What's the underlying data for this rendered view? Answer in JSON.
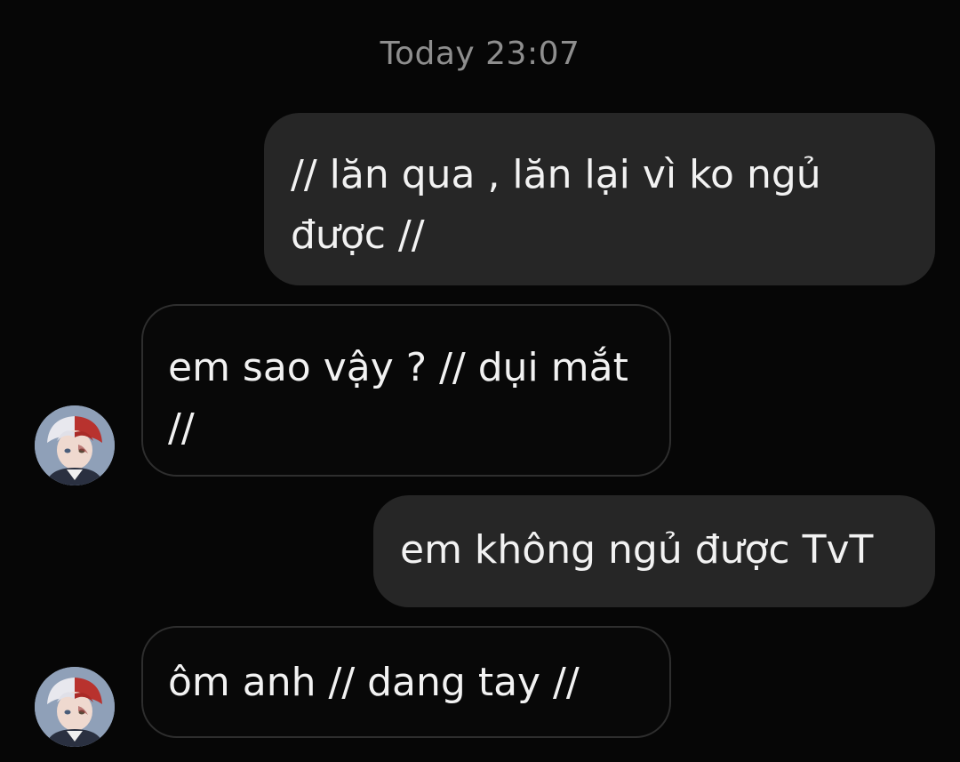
{
  "conversation": {
    "timestamp": "Today 23:07",
    "messages": [
      {
        "direction": "outgoing",
        "text": "// lăn qua , lăn lại vì ko ngủ được //"
      },
      {
        "direction": "incoming",
        "text": "em sao vậy ? // dụi mắt //",
        "avatar": "anime-avatar-icon"
      },
      {
        "direction": "outgoing",
        "text": "em không ngủ được TvT"
      },
      {
        "direction": "incoming",
        "text": "ôm anh // dang tay //",
        "avatar": "anime-avatar-icon"
      }
    ]
  },
  "colors": {
    "background": "#060606",
    "outgoing_bubble": "#262626",
    "incoming_bubble_border": "#2e2e2e",
    "text": "#f2f2f2",
    "timestamp": "#8e8e8e"
  }
}
